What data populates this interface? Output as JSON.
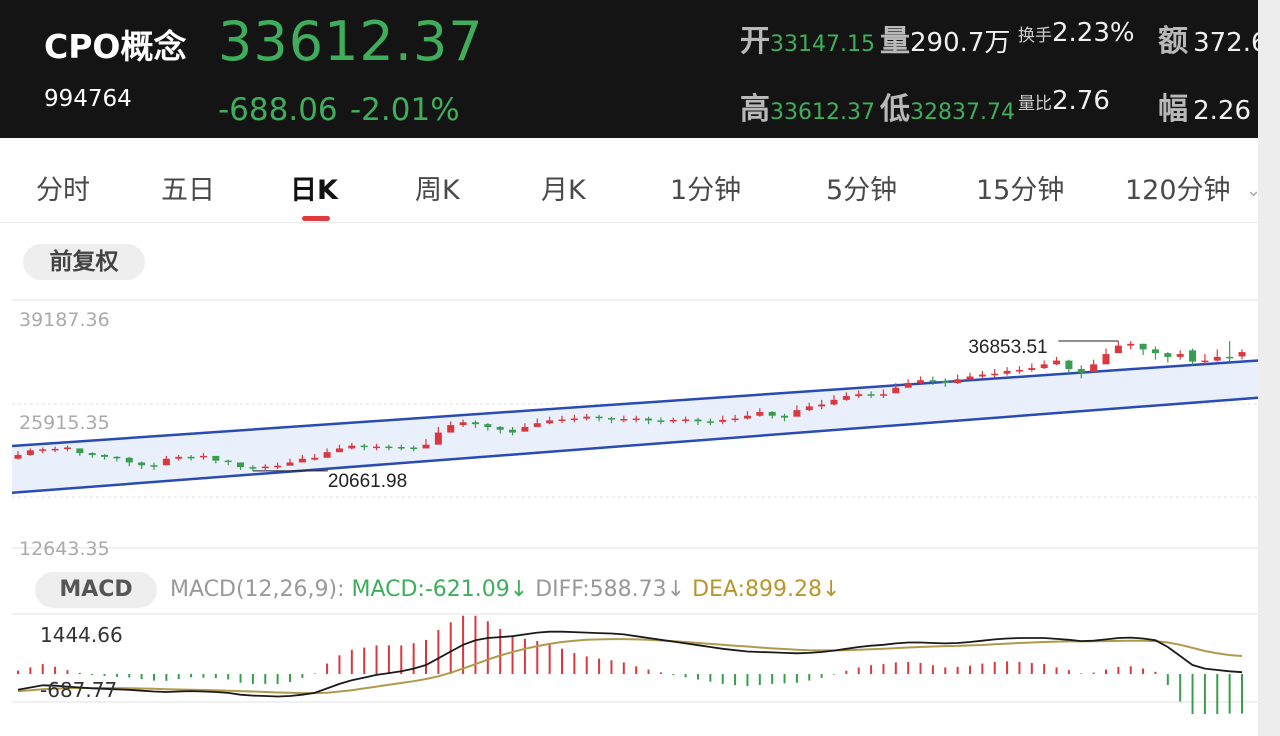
{
  "header": {
    "name": "CPO概念",
    "code": "994764",
    "price": "33612.37",
    "change": "-688.06",
    "change_pct": "-2.01%",
    "stats": {
      "open_label": "开",
      "open": "33147.15",
      "volume_label": "量",
      "volume": "290.7万",
      "turnover_label": "换手",
      "turnover": "2.23%",
      "amount_label": "额",
      "amount": "372.6",
      "high_label": "高",
      "high": "33612.37",
      "low_label": "低",
      "low": "32837.74",
      "vol_ratio_label": "量比",
      "vol_ratio": "2.76",
      "amp_label": "幅",
      "amp": "2.26"
    }
  },
  "tabs": [
    "分时",
    "五日",
    "日K",
    "周K",
    "月K",
    "1分钟",
    "5分钟",
    "15分钟",
    "120分钟"
  ],
  "active_tab": "日K",
  "adjust_button": "前复权",
  "colors": {
    "up": "#d9383f",
    "down": "#3a9c4e",
    "channel": "#2a4bb3",
    "dif": "#1a1a1a",
    "dea": "#b09a4a"
  },
  "chart_data": [
    {
      "type": "candlestick",
      "y_axis_labels": [
        "39187.36",
        "25915.35",
        "12643.35"
      ],
      "ylim": [
        12643.35,
        39187.36
      ],
      "annotations": [
        {
          "label": "36853.51",
          "kind": "max"
        },
        {
          "label": "20661.98",
          "kind": "min"
        }
      ],
      "channel": {
        "upper": [
          [
            0,
            23600
          ],
          [
            99,
            32600
          ]
        ],
        "lower": [
          [
            0,
            18600
          ],
          [
            99,
            28600
          ]
        ]
      },
      "close": [
        22600,
        23100,
        23200,
        23250,
        23400,
        22800,
        22600,
        22400,
        22300,
        21800,
        21500,
        21450,
        22200,
        22400,
        22350,
        22500,
        22000,
        21900,
        21300,
        21200,
        21350,
        21450,
        21800,
        22200,
        22300,
        22900,
        23300,
        23600,
        23450,
        23500,
        23450,
        23400,
        23300,
        23700,
        25000,
        25800,
        26100,
        25900,
        25600,
        25300,
        25000,
        25600,
        26000,
        26300,
        26400,
        26500,
        26700,
        26550,
        26400,
        26450,
        26500,
        26300,
        26250,
        26350,
        26400,
        26200,
        26150,
        26350,
        26500,
        26800,
        27200,
        26800,
        26600,
        27400,
        27800,
        28000,
        28500,
        28900,
        29100,
        29000,
        29100,
        29800,
        30300,
        30600,
        30500,
        30300,
        30700,
        31000,
        31200,
        31300,
        31600,
        31700,
        31900,
        32300,
        32700,
        31800,
        31400,
        32300,
        33400,
        34300,
        34500,
        33900,
        33500,
        33100,
        33400,
        32600,
        32700,
        33100,
        33000,
        33612
      ],
      "high": [
        23000,
        23300,
        23400,
        23500,
        23600,
        23300,
        22900,
        22700,
        22500,
        22400,
        21900,
        21800,
        22500,
        22600,
        22600,
        22800,
        22400,
        22100,
        21800,
        21500,
        21600,
        21800,
        22200,
        22600,
        22700,
        23300,
        23700,
        23900,
        23800,
        23800,
        23700,
        23700,
        23600,
        24300,
        25600,
        26200,
        26400,
        26300,
        26000,
        25700,
        25600,
        26000,
        26500,
        26700,
        26800,
        26900,
        27000,
        26900,
        26700,
        26800,
        26800,
        26700,
        26600,
        26600,
        26700,
        26600,
        26500,
        26800,
        26900,
        27300,
        27600,
        27300,
        27000,
        27900,
        28200,
        28500,
        29000,
        29300,
        29500,
        29400,
        29600,
        30300,
        30700,
        31000,
        31000,
        30800,
        31200,
        31400,
        31600,
        31800,
        32000,
        32100,
        32400,
        32700,
        33100,
        32800,
        32200,
        32800,
        34000,
        34800,
        34800,
        34500,
        34200,
        33600,
        33800,
        34000,
        33400,
        33900,
        34800,
        33900
      ],
      "low": [
        22100,
        22500,
        22800,
        22900,
        23000,
        22500,
        22300,
        22100,
        21900,
        21400,
        21100,
        21000,
        21600,
        22000,
        22000,
        22100,
        21700,
        21500,
        21000,
        20900,
        21000,
        21100,
        21500,
        21800,
        22000,
        22400,
        22900,
        23200,
        23100,
        23100,
        23100,
        23100,
        23000,
        23300,
        23900,
        25200,
        25600,
        25500,
        25200,
        24900,
        24700,
        25100,
        25600,
        25900,
        26000,
        26100,
        26300,
        26200,
        26000,
        26100,
        26100,
        25900,
        25900,
        26000,
        26000,
        25800,
        25800,
        25900,
        26100,
        26400,
        26700,
        26500,
        26200,
        26700,
        27300,
        27500,
        27900,
        28400,
        28700,
        28700,
        28700,
        29200,
        29800,
        30200,
        30100,
        29900,
        30200,
        30600,
        30800,
        30900,
        31100,
        31300,
        31500,
        31800,
        32200,
        31300,
        30800,
        31400,
        32400,
        33600,
        33900,
        33300,
        32800,
        32500,
        32800,
        32200,
        32300,
        32600,
        32600,
        32837
      ],
      "open": [
        22200,
        22600,
        23100,
        23200,
        23300,
        23300,
        22800,
        22600,
        22400,
        22300,
        21800,
        21500,
        21500,
        22200,
        22400,
        22350,
        22500,
        22000,
        21800,
        21300,
        21200,
        21350,
        21450,
        21800,
        22100,
        22300,
        22900,
        23300,
        23600,
        23450,
        23500,
        23450,
        23400,
        23300,
        23700,
        25000,
        25800,
        26100,
        25900,
        25600,
        25300,
        25100,
        25600,
        26000,
        26300,
        26400,
        26500,
        26700,
        26550,
        26400,
        26450,
        26500,
        26300,
        26250,
        26350,
        26400,
        26200,
        26150,
        26350,
        26500,
        26800,
        27200,
        26800,
        26700,
        27400,
        27800,
        28000,
        28500,
        28900,
        29100,
        29000,
        29200,
        29800,
        30300,
        30600,
        30500,
        30300,
        30700,
        31000,
        31200,
        31300,
        31600,
        31700,
        31900,
        32300,
        32700,
        31800,
        31500,
        32300,
        33500,
        34300,
        34500,
        33900,
        33500,
        33100,
        33800,
        32600,
        32700,
        33100,
        33147
      ]
    },
    {
      "type": "macd",
      "indicator_label": "MACD",
      "params_label": "MACD(12,26,9):",
      "macd_value_label": "MACD:-621.09↓",
      "diff_label": "DIFF:588.73↓",
      "dea_label": "DEA:899.28↓",
      "y_axis_labels": [
        "1444.66",
        "-687.77"
      ],
      "ylim": [
        -687.77,
        1444.66
      ],
      "dif": [
        150,
        200,
        250,
        240,
        220,
        200,
        180,
        170,
        160,
        150,
        130,
        110,
        100,
        110,
        120,
        110,
        100,
        80,
        40,
        20,
        10,
        0,
        10,
        40,
        80,
        180,
        280,
        360,
        420,
        480,
        520,
        560,
        620,
        700,
        850,
        1000,
        1150,
        1250,
        1300,
        1320,
        1340,
        1380,
        1420,
        1440,
        1440,
        1430,
        1420,
        1410,
        1400,
        1380,
        1340,
        1300,
        1260,
        1220,
        1180,
        1140,
        1100,
        1060,
        1030,
        1000,
        990,
        980,
        970,
        960,
        970,
        990,
        1020,
        1060,
        1100,
        1130,
        1150,
        1180,
        1200,
        1200,
        1190,
        1180,
        1190,
        1210,
        1240,
        1270,
        1290,
        1300,
        1300,
        1300,
        1280,
        1260,
        1230,
        1240,
        1270,
        1300,
        1310,
        1290,
        1250,
        1100,
        900,
        700,
        620,
        590,
        560,
        540
      ],
      "dea": [
        120,
        140,
        160,
        175,
        185,
        190,
        190,
        188,
        186,
        182,
        177,
        170,
        162,
        156,
        150,
        144,
        138,
        130,
        120,
        110,
        100,
        90,
        82,
        75,
        75,
        85,
        110,
        140,
        180,
        220,
        260,
        300,
        340,
        390,
        450,
        530,
        620,
        720,
        820,
        910,
        990,
        1060,
        1120,
        1170,
        1210,
        1240,
        1260,
        1270,
        1275,
        1275,
        1270,
        1260,
        1245,
        1230,
        1210,
        1190,
        1170,
        1150,
        1130,
        1110,
        1090,
        1070,
        1055,
        1040,
        1030,
        1025,
        1025,
        1030,
        1040,
        1050,
        1060,
        1075,
        1090,
        1100,
        1110,
        1120,
        1125,
        1135,
        1145,
        1160,
        1175,
        1190,
        1200,
        1210,
        1220,
        1225,
        1225,
        1227,
        1230,
        1235,
        1240,
        1240,
        1230,
        1200,
        1150,
        1080,
        1010,
        960,
        920,
        899
      ]
    }
  ]
}
